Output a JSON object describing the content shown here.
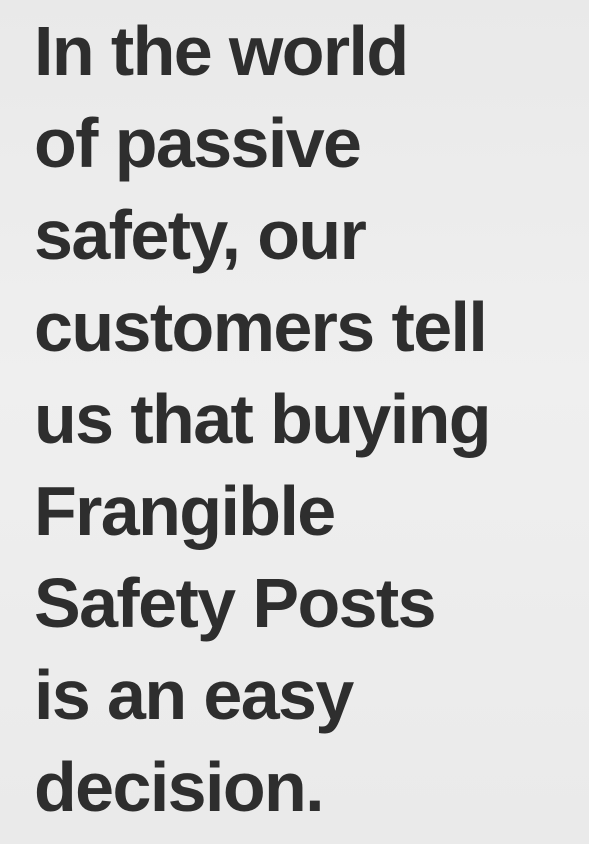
{
  "headline": {
    "lines": [
      "In the world",
      "of passive",
      "safety, our",
      "customers tell",
      "us that buying",
      "Frangible",
      "Safety Posts",
      "is an easy",
      "decision."
    ]
  },
  "colors": {
    "text": "#2e2e2e",
    "background": "#ececec"
  }
}
